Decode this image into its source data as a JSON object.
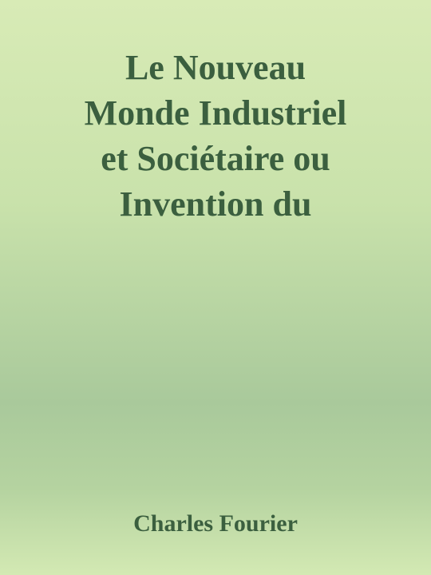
{
  "cover": {
    "title_lines": [
      "Le Nouveau",
      "Monde Industriel",
      "et Sociétaire ou",
      "Invention du"
    ],
    "author": "Charles Fourier"
  }
}
